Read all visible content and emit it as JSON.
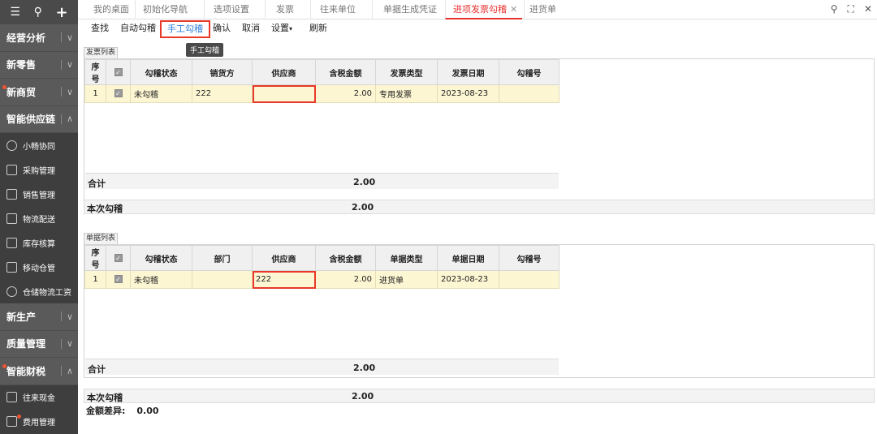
{
  "sidebar": {
    "sections": [
      {
        "label": "经营分析"
      },
      {
        "label": "新零售"
      },
      {
        "label": "新商贸"
      },
      {
        "label": "智能供应链"
      }
    ],
    "subitems": [
      {
        "label": "小畅协同"
      },
      {
        "label": "采购管理"
      },
      {
        "label": "销售管理"
      },
      {
        "label": "物流配送"
      },
      {
        "label": "库存核算"
      },
      {
        "label": "移动仓管"
      },
      {
        "label": "仓储物流工资"
      }
    ],
    "sections2": [
      {
        "label": "新生产"
      },
      {
        "label": "质量管理"
      },
      {
        "label": "智能财税"
      }
    ],
    "subitems2": [
      {
        "label": "往来现金"
      },
      {
        "label": "费用管理"
      }
    ]
  },
  "tabs": [
    "我的桌面",
    "初始化导航",
    "选项设置",
    "发票",
    "往来单位",
    "单据生成凭证",
    "进项发票勾稽",
    "进货单"
  ],
  "toolbar": {
    "find": "查找",
    "auto": "自动勾稽",
    "manual": "手工勾稽",
    "confirm": "确认",
    "cancel": "取消",
    "settings": "设置",
    "refresh": "刷新",
    "tooltip": "手工勾稽"
  },
  "invoice": {
    "caption": "发票列表",
    "headers": [
      "序号",
      "",
      "勾稽状态",
      "销货方",
      "供应商",
      "含税金额",
      "发票类型",
      "发票日期",
      "勾稽号"
    ],
    "row": {
      "no": "1",
      "status": "未勾稽",
      "seller": "222",
      "supplier": "",
      "amount": "2.00",
      "type": "专用发票",
      "date": "2023-08-23",
      "code": ""
    },
    "total_label": "合计",
    "total": "2.00",
    "this_label": "本次勾稽",
    "this_value": "2.00"
  },
  "bill": {
    "caption": "单据列表",
    "headers": [
      "序号",
      "",
      "勾稽状态",
      "部门",
      "供应商",
      "含税金额",
      "单据类型",
      "单据日期",
      "勾稽号"
    ],
    "row": {
      "no": "1",
      "status": "未勾稽",
      "dept": "",
      "supplier": "222",
      "amount": "2.00",
      "type": "进货单",
      "date": "2023-08-23",
      "code": ""
    },
    "total_label": "合计",
    "total": "2.00",
    "this_label": "本次勾稽",
    "this_value": "2.00"
  },
  "diff": {
    "label": "金额差异:",
    "value": "0.00"
  },
  "colors": {
    "accent": "#e83030",
    "highlight": "#e8382a",
    "row": "#fdf6d3",
    "sidebar": "#5a5a5a"
  }
}
